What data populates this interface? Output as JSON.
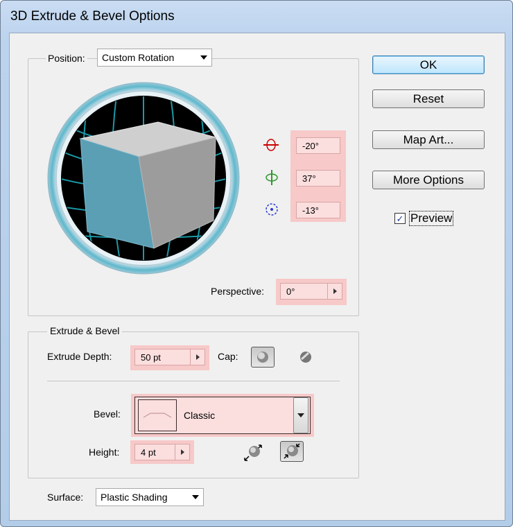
{
  "window": {
    "title": "3D Extrude & Bevel Options"
  },
  "position": {
    "label": "Position:",
    "preset": "Custom Rotation",
    "x_rotation": "-20°",
    "y_rotation": "37°",
    "z_rotation": "-13°",
    "perspective_label": "Perspective:",
    "perspective": "0°"
  },
  "extrude_bevel": {
    "group_label": "Extrude & Bevel",
    "depth_label": "Extrude Depth:",
    "depth": "50 pt",
    "cap_label": "Cap:",
    "bevel_label": "Bevel:",
    "bevel": "Classic",
    "height_label": "Height:",
    "height": "4 pt"
  },
  "surface": {
    "label": "Surface:",
    "value": "Plastic Shading"
  },
  "buttons": {
    "ok": "OK",
    "reset": "Reset",
    "map_art": "Map Art...",
    "more_options": "More Options"
  },
  "preview": {
    "label": "Preview",
    "checked": true
  },
  "colors": {
    "highlight": "#f7c9c9",
    "cube_front": "#5b9fb5",
    "cube_top": "#cfcfcf",
    "cube_side": "#9c9c9c",
    "grid": "#1a9aa8"
  }
}
